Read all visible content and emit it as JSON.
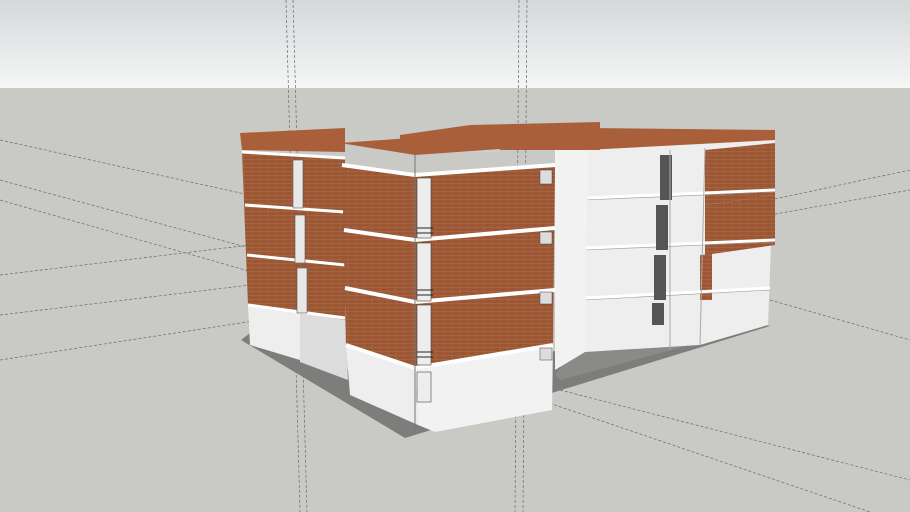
{
  "scene": {
    "sky_top": "#d7dadc",
    "sky_bottom": "#f4f5f5",
    "ground": "#c9c9c5",
    "brick": "#9b5634",
    "brick_roof": "#a9603a",
    "wall": "#eeeeee",
    "wall_shade": "#dcdcdc",
    "slab": "#7d7d7b"
  }
}
